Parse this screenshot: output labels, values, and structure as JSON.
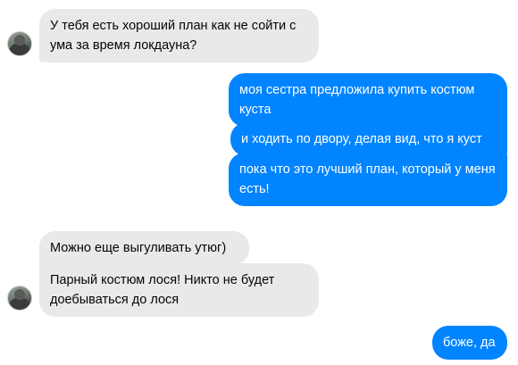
{
  "conversation": {
    "messages": [
      {
        "from": "them",
        "text": "У тебя есть хороший план как не сойти с ума за время локдауна?"
      },
      {
        "from": "me",
        "text": "моя сестра предложила купить костюм куста"
      },
      {
        "from": "me",
        "text": "и ходить по двору, делая вид, что я куст"
      },
      {
        "from": "me",
        "text": "пока что это лучший план, который у меня есть!"
      },
      {
        "from": "them",
        "text": "Можно еще выгуливать утюг)"
      },
      {
        "from": "them",
        "text": "Парный костюм лося! Никто не будет доебываться до лося"
      },
      {
        "from": "me",
        "text": "боже, да"
      }
    ]
  },
  "colors": {
    "incoming_bubble": "#e9e9eb",
    "outgoing_bubble": "#0084ff"
  },
  "icons": {
    "contact_avatar": "contact-avatar-photo"
  }
}
